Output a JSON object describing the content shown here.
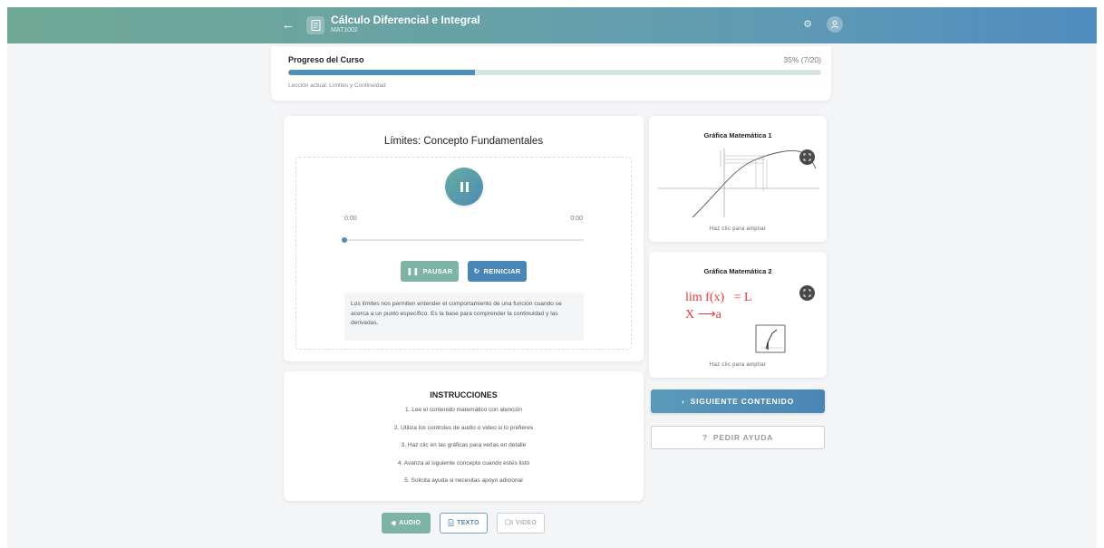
{
  "header": {
    "title": "Cálculo Diferencial e Integral",
    "course_code": "MAT1002"
  },
  "progress": {
    "title": "Progreso del Curso",
    "percent_text": "35% (7/20)",
    "value": 0.35,
    "current_lesson": "Lección actual: Límites y Continuidad"
  },
  "player": {
    "title": "Límites: Concepto Fundamentales",
    "time_current": "0:00",
    "time_total": "0:00",
    "pause_label": "PAUSAR",
    "restart_label": "REINICIAR",
    "description": "Los límites nos permiten entender el comportamiento de una función cuando se acerca a un punto específico. Es la base para comprender la continuidad y las derivadas."
  },
  "instructions": {
    "title": "INSTRUCCIONES",
    "items": [
      "1. Lee el contenido matemático con atención",
      "2. Utiliza los controles de audio o video si lo prefieres",
      "3. Haz clic en las gráficas para verlas en detalle",
      "4. Avanza al siguiente concepto cuando estés listo",
      "5. Solicita ayuda si necesitas apoyo adicional"
    ]
  },
  "graphs": [
    {
      "title": "Gráfica Matemática 1",
      "hint": "Haz clic para ampliar"
    },
    {
      "title": "Gráfica Matemática 2",
      "hint": "Haz clic para ampliar",
      "formula_line1": "lim f(x)   = L",
      "formula_line2": "X ⟶a"
    }
  ],
  "actions": {
    "next_label": "SIGUIENTE CONTENIDO",
    "help_label": "PEDIR AYUDA"
  },
  "modes": {
    "audio": "AUDIO",
    "text": "TEXTO",
    "video": "VIDEO"
  },
  "colors": {
    "accent_green": "#7db4a6",
    "accent_blue": "#4a86b5",
    "formula_red": "#e53935"
  }
}
